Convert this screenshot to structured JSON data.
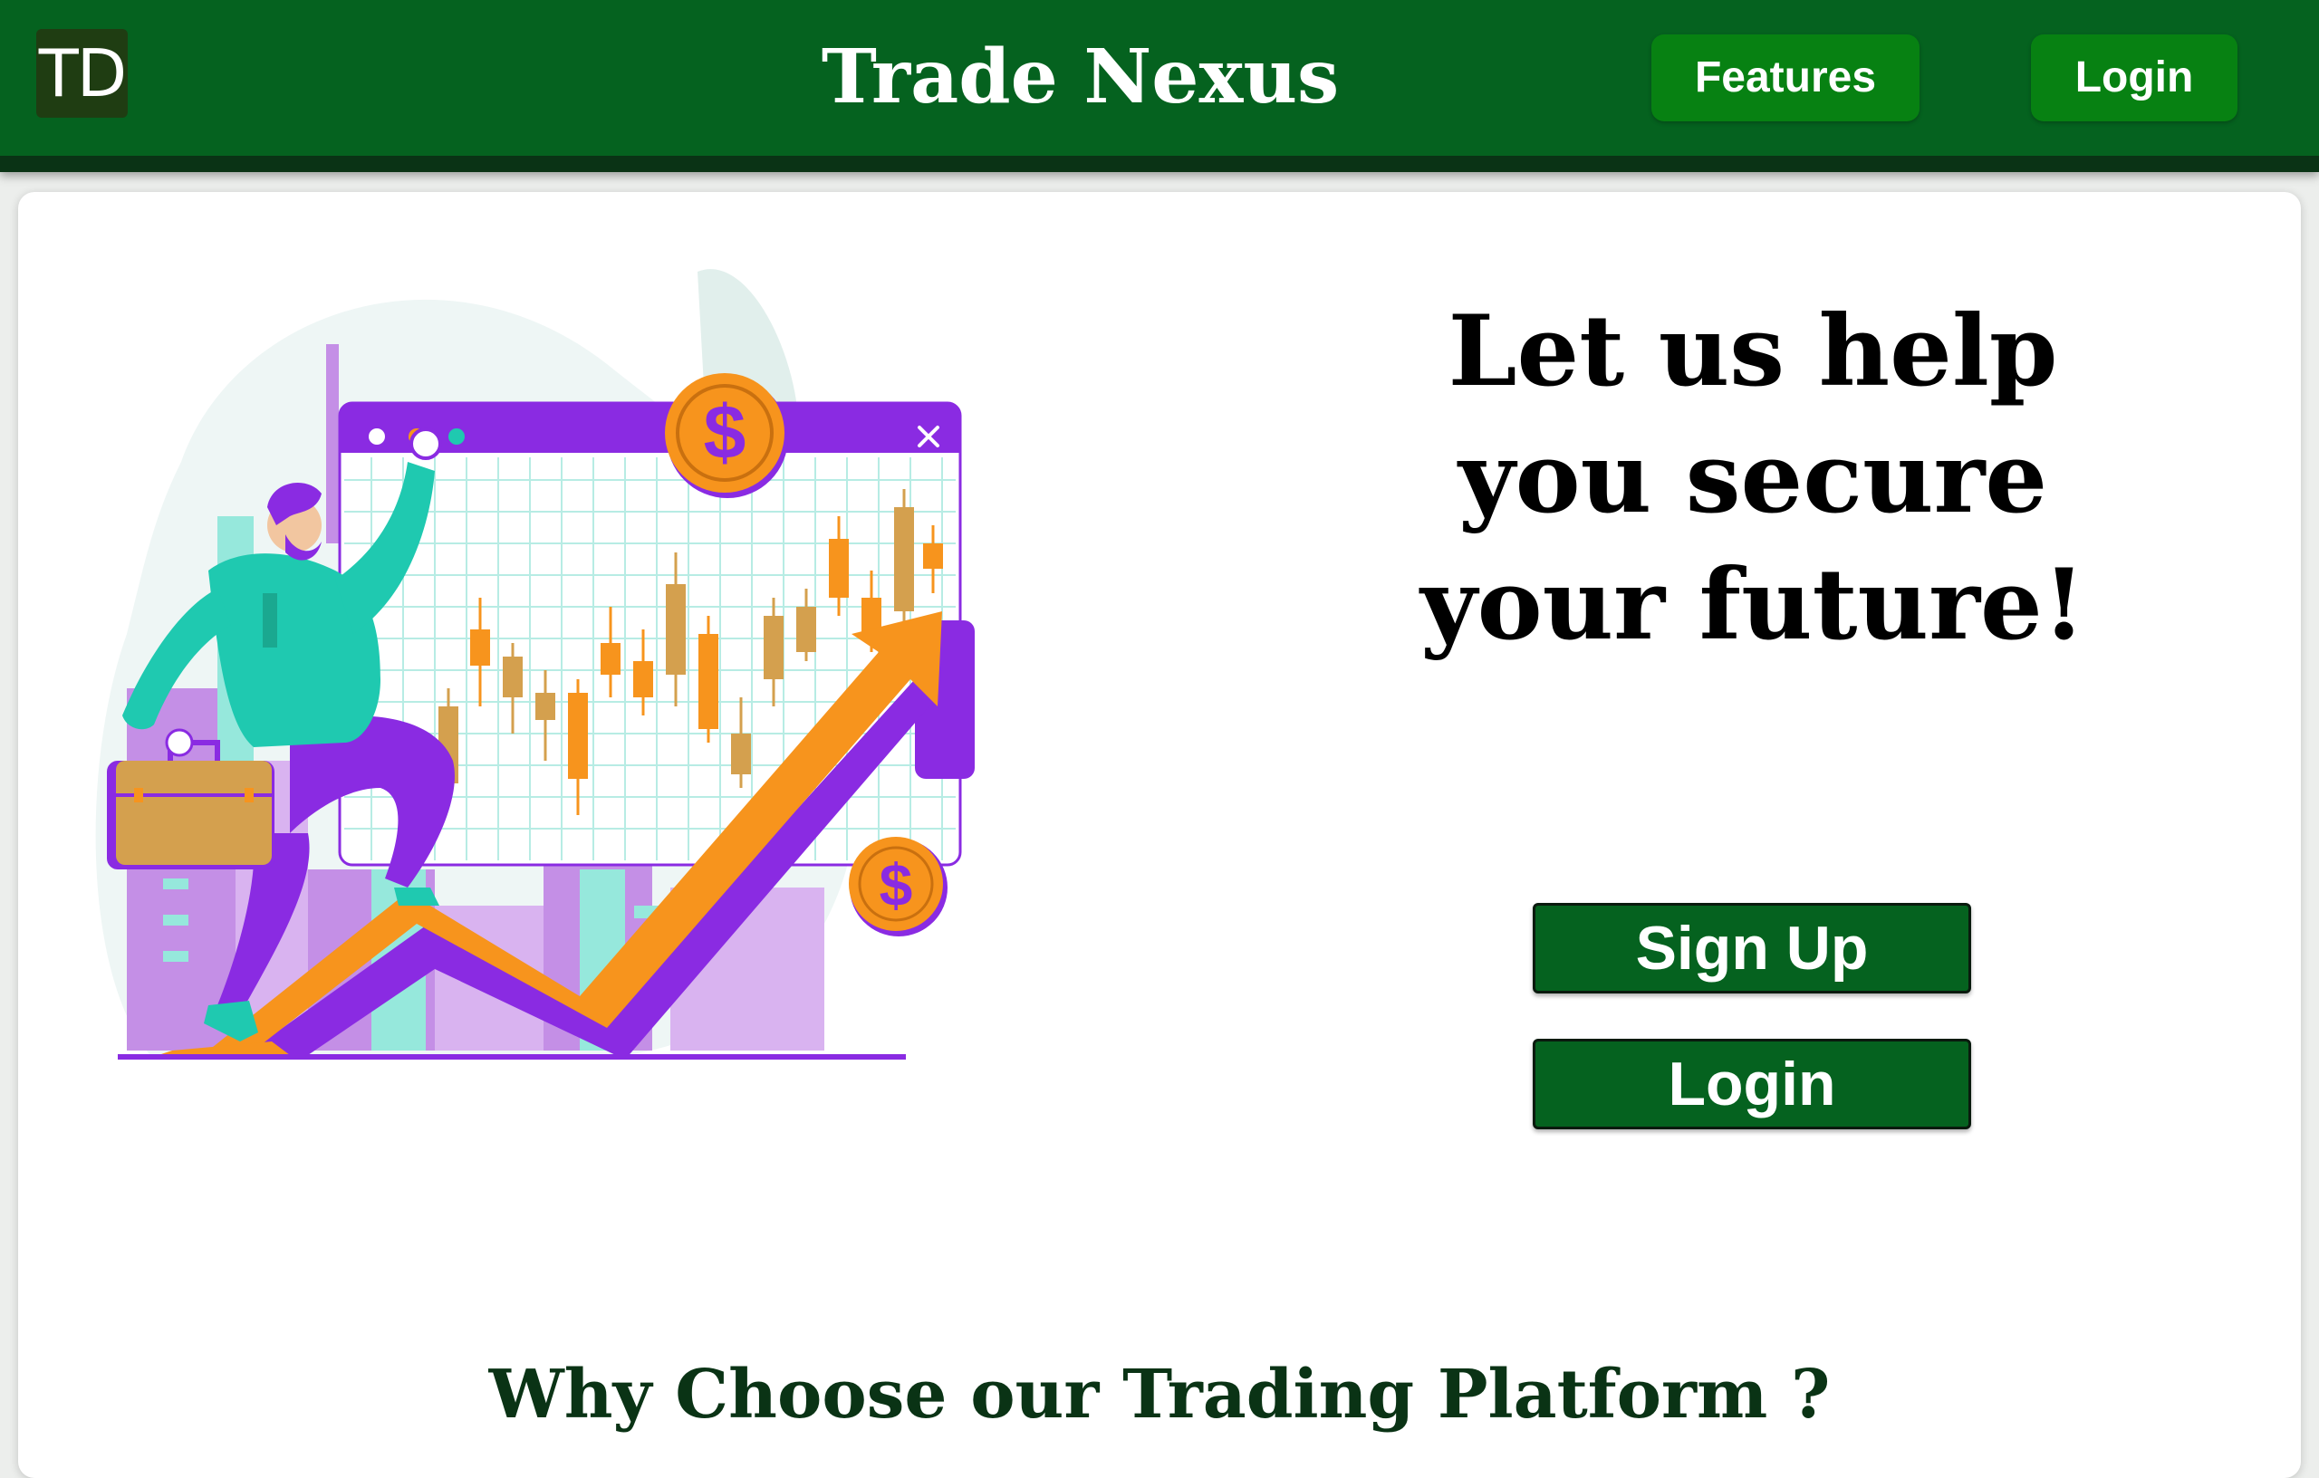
{
  "header": {
    "logo_text": "TD",
    "title": "Trade Nexus",
    "nav": {
      "features_label": "Features",
      "login_label": "Login"
    }
  },
  "hero": {
    "headline": "Let us help you secure your future!",
    "illustration": {
      "icon_names": [
        "businessman-figure",
        "briefcase-icon",
        "candlestick-chart-window",
        "dollar-coin-icon",
        "growth-arrow-icon"
      ],
      "colors": {
        "purple": "#8a2be2",
        "orange": "#f7941d",
        "teal": "#1fc9b0",
        "tan": "#d4a04e",
        "lavender": "#c48fe6"
      }
    },
    "buttons": {
      "signup_label": "Sign Up",
      "login_label": "Login"
    }
  },
  "section": {
    "heading": "Why Choose our Trading Platform ?"
  },
  "colors": {
    "navbar": "#05621f",
    "navbar_border": "#0a3315",
    "nav_button": "#078112",
    "cta_button": "#05621f",
    "heading_text": "#0a3315"
  }
}
